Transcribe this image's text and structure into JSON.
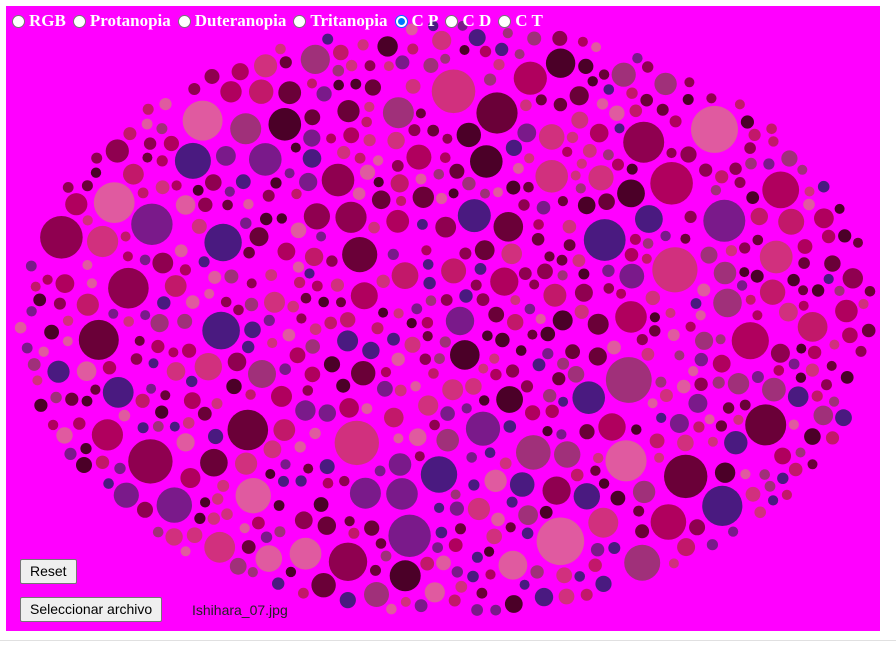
{
  "modes": [
    {
      "label": "RGB",
      "checked": false
    },
    {
      "label": "Protanopia",
      "checked": false
    },
    {
      "label": "Duteranopia",
      "checked": false
    },
    {
      "label": "Tritanopia",
      "checked": false
    },
    {
      "label": "C P",
      "checked": true
    },
    {
      "label": "C D",
      "checked": false
    },
    {
      "label": "C T",
      "checked": false
    }
  ],
  "buttons": {
    "reset_label": "Reset",
    "choose_file_label": "Seleccionar archivo"
  },
  "file": {
    "name": "Ishihara_07.jpg"
  },
  "colors": {
    "background": "#ff00ff",
    "accent": "#0075ff",
    "dot_palette": [
      "#b0005e",
      "#c2186a",
      "#d1307e",
      "#8f0050",
      "#6a0038",
      "#4b0028",
      "#7a1a8a",
      "#4a1a80",
      "#a0307a",
      "#e05aa0"
    ]
  },
  "image": {
    "icon": "ishihara-plate-icon"
  }
}
